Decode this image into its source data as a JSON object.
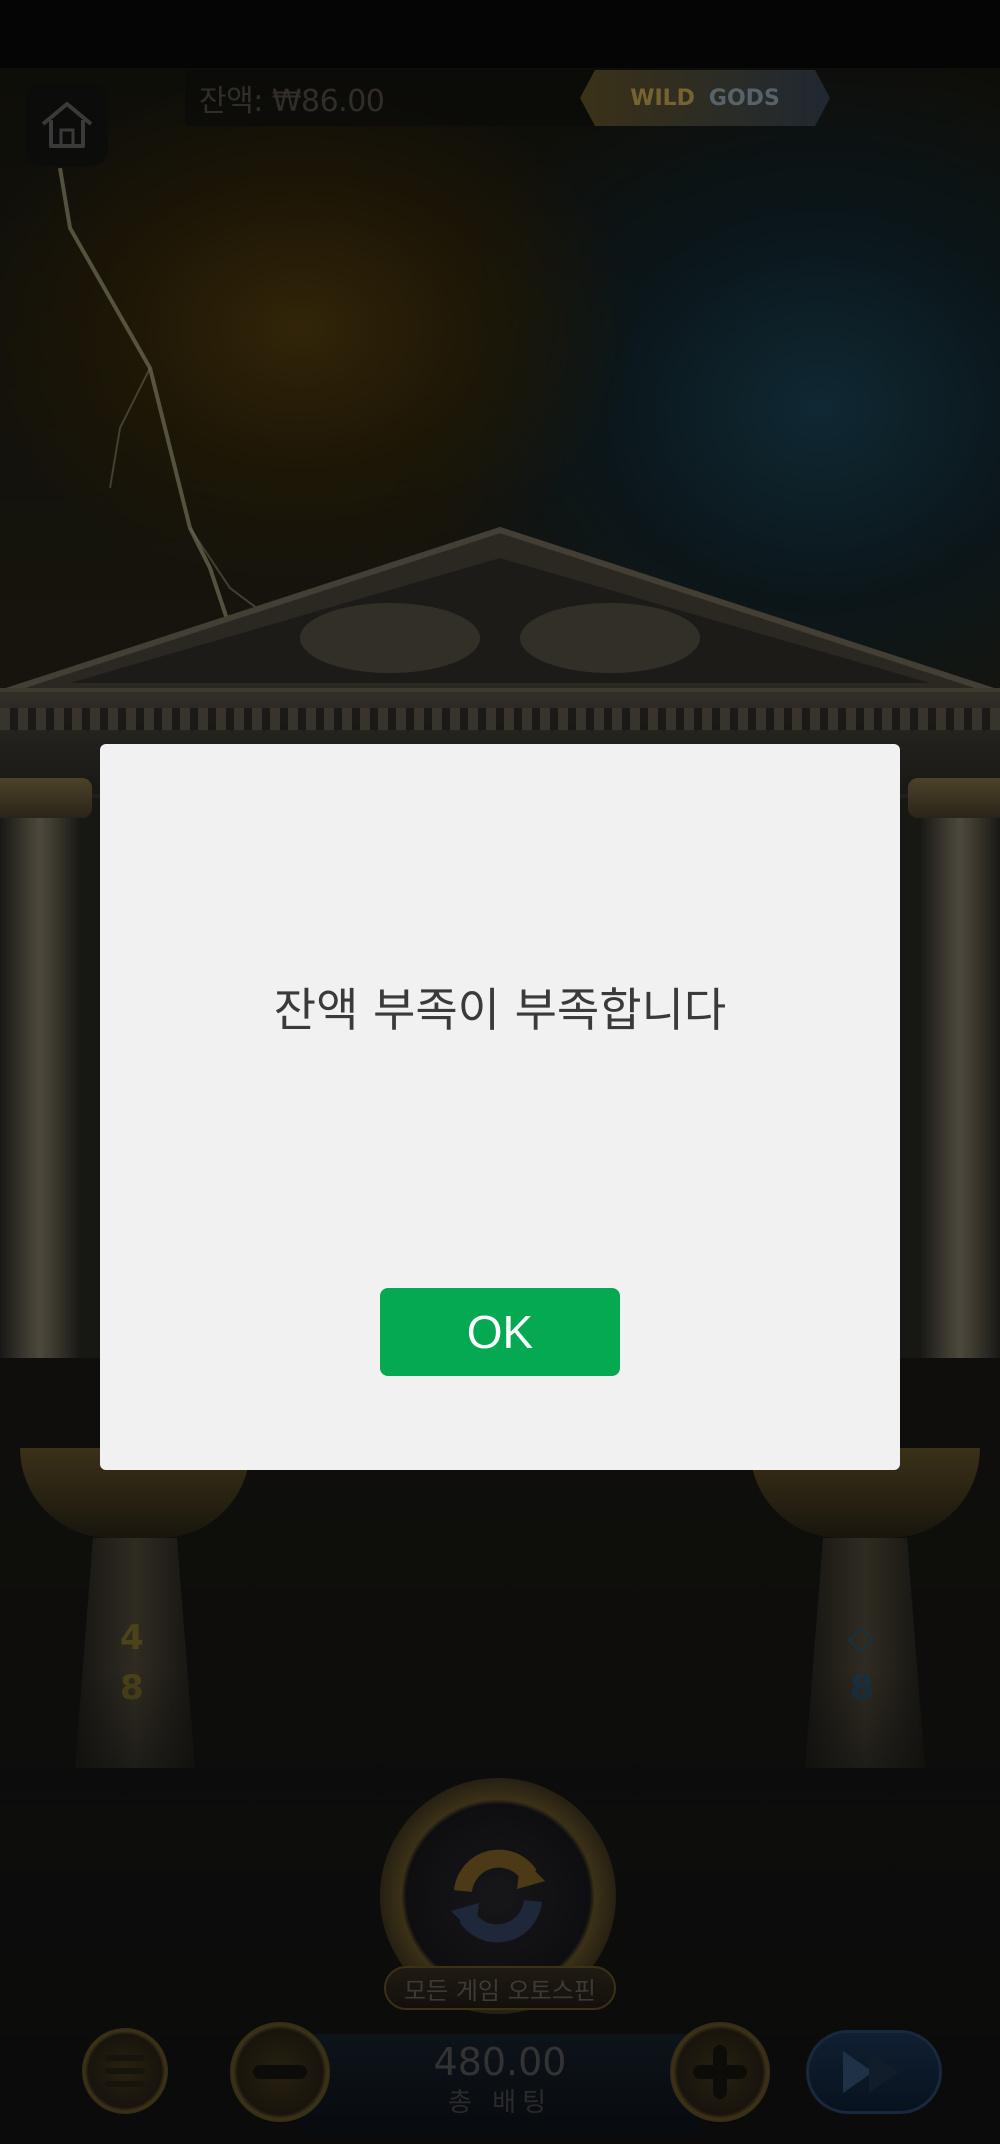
{
  "header": {
    "balance_text": "잔액: ₩86.00",
    "logo_wild": "WILD",
    "logo_gods": "GODS",
    "home_icon": "home-icon"
  },
  "pedestals": {
    "left_glyphs": [
      "4",
      "8"
    ],
    "right_glyphs": [
      "◇",
      "8"
    ]
  },
  "controls": {
    "autospin_label": "모든 게임 오토스핀",
    "bet_value": "480.00",
    "bet_label": "총 배팅",
    "icons": [
      "menu-icon",
      "minus-icon",
      "spin-icon",
      "plus-icon",
      "turbo-icon"
    ]
  },
  "dialog": {
    "message": "잔액 부족이 부족합니다",
    "ok_label": "OK"
  },
  "colors": {
    "ok_button": "#05a952",
    "dialog_bg": "#f1f1f1",
    "status_bar": "#050505"
  }
}
